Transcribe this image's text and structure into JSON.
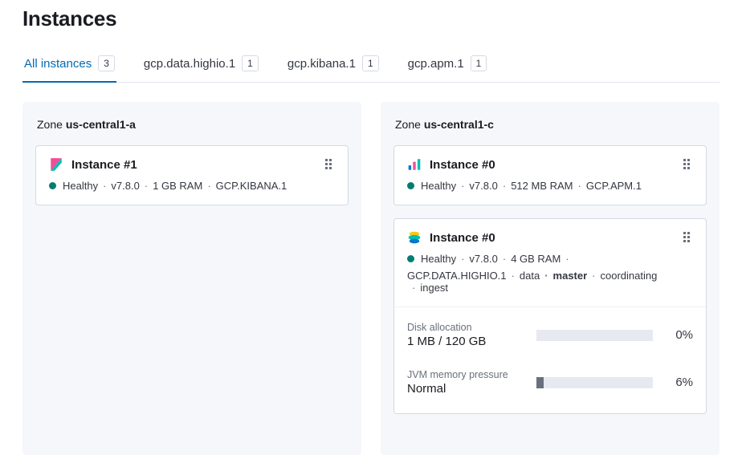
{
  "page": {
    "title": "Instances"
  },
  "tabs": [
    {
      "label": "All instances",
      "count": "3",
      "active": true
    },
    {
      "label": "gcp.data.highio.1",
      "count": "1",
      "active": false
    },
    {
      "label": "gcp.kibana.1",
      "count": "1",
      "active": false
    },
    {
      "label": "gcp.apm.1",
      "count": "1",
      "active": false
    }
  ],
  "zones": [
    {
      "prefix": "Zone ",
      "name": "us-central1-a",
      "cards": [
        {
          "icon": "kibana",
          "title": "Instance #1",
          "health": "Healthy",
          "version": "v7.8.0",
          "ram": "1 GB RAM",
          "config": "GCP.KIBANA.1",
          "roles": [],
          "metrics": []
        }
      ]
    },
    {
      "prefix": "Zone ",
      "name": "us-central1-c",
      "cards": [
        {
          "icon": "apm",
          "title": "Instance #0",
          "health": "Healthy",
          "version": "v7.8.0",
          "ram": "512 MB RAM",
          "config": "GCP.APM.1",
          "roles": [],
          "metrics": []
        },
        {
          "icon": "elastic",
          "title": "Instance #0",
          "health": "Healthy",
          "version": "v7.8.0",
          "ram": "4 GB RAM",
          "config": "GCP.DATA.HIGHIO.1",
          "roles": [
            "data",
            "master",
            "coordinating",
            "ingest"
          ],
          "metrics": [
            {
              "label": "Disk allocation",
              "value": "1 MB / 120 GB",
              "pct": "0%",
              "fill": 0
            },
            {
              "label": "JVM memory pressure",
              "value": "Normal",
              "pct": "6%",
              "fill": 6
            }
          ]
        }
      ]
    }
  ]
}
